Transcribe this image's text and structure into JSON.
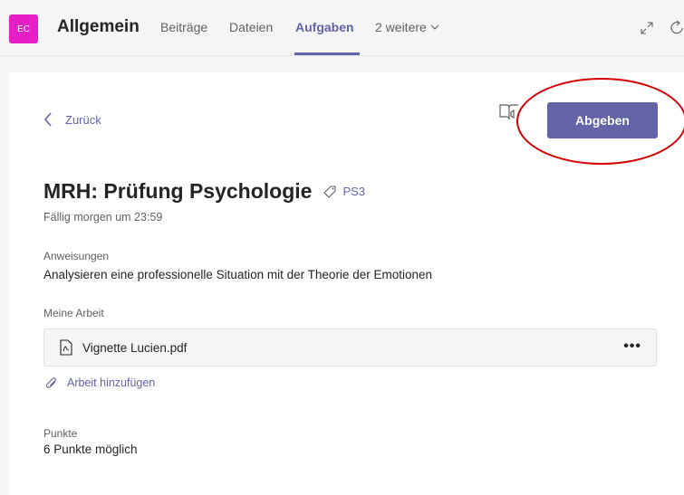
{
  "header": {
    "team_initials": "EC",
    "channel": "Allgemein",
    "tabs": [
      "Beiträge",
      "Dateien",
      "Aufgaben",
      "2 weitere"
    ],
    "active_tab": "Aufgaben",
    "accent": "#6264a7",
    "avatar_color": "#e61ec8"
  },
  "assignment": {
    "back_label": "Zurück",
    "submit_label": "Abgeben",
    "title": "MRH: Prüfung Psychologie",
    "tag": "PS3",
    "due": "Fällig morgen um 23:59",
    "instructions_label": "Anweisungen",
    "instructions": "Analysieren eine professionelle Situation mit der Theorie der Emotionen",
    "my_work_label": "Meine Arbeit",
    "file_name": "Vignette Lucien.pdf",
    "more_label": "•••",
    "add_work_label": "Arbeit hinzufügen",
    "points_label": "Punkte",
    "points_value": "6 Punkte möglich"
  },
  "icons": {
    "back": "chevron-left-icon",
    "reader": "immersive-reader-icon",
    "tag": "tag-icon",
    "file": "pdf-file-icon",
    "attach": "paperclip-icon",
    "expand": "expand-icon",
    "refresh": "refresh-icon"
  },
  "annotation": {
    "highlight_color": "#d40000"
  }
}
